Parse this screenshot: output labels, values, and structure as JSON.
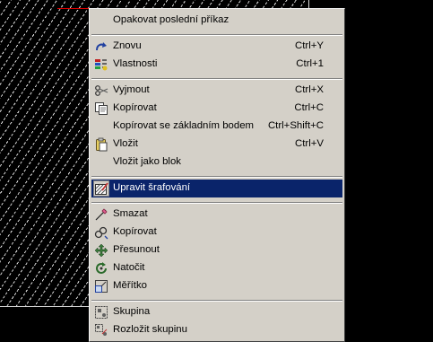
{
  "menu": {
    "items": [
      {
        "label": "Opakovat poslední příkaz",
        "shortcut": "",
        "icon": "none"
      },
      {
        "label": "Znovu",
        "shortcut": "Ctrl+Y",
        "icon": "redo-icon"
      },
      {
        "label": "Vlastnosti",
        "shortcut": "Ctrl+1",
        "icon": "properties-icon"
      },
      {
        "label": "Vyjmout",
        "shortcut": "Ctrl+X",
        "icon": "scissors-icon"
      },
      {
        "label": "Kopírovat",
        "shortcut": "Ctrl+C",
        "icon": "copy-icon"
      },
      {
        "label": "Kopírovat se základním bodem",
        "shortcut": "Ctrl+Shift+C",
        "icon": "none"
      },
      {
        "label": "Vložit",
        "shortcut": "Ctrl+V",
        "icon": "paste-icon"
      },
      {
        "label": "Vložit jako blok",
        "shortcut": "",
        "icon": "none"
      },
      {
        "label": "Upravit šrafování",
        "shortcut": "",
        "icon": "hatch-edit-icon",
        "selected": true
      },
      {
        "label": "Smazat",
        "shortcut": "",
        "icon": "erase-icon"
      },
      {
        "label": "Kopírovat",
        "shortcut": "",
        "icon": "copy-object-icon"
      },
      {
        "label": "Přesunout",
        "shortcut": "",
        "icon": "move-icon"
      },
      {
        "label": "Natočit",
        "shortcut": "",
        "icon": "rotate-icon"
      },
      {
        "label": "Měřítko",
        "shortcut": "",
        "icon": "scale-icon"
      },
      {
        "label": "Skupina",
        "shortcut": "",
        "icon": "group-icon"
      },
      {
        "label": "Rozložit skupinu",
        "shortcut": "",
        "icon": "ungroup-icon"
      }
    ]
  },
  "colors": {
    "menu_background": "#d4d0c8",
    "selection": "#0a246a",
    "canvas": "#000000"
  }
}
